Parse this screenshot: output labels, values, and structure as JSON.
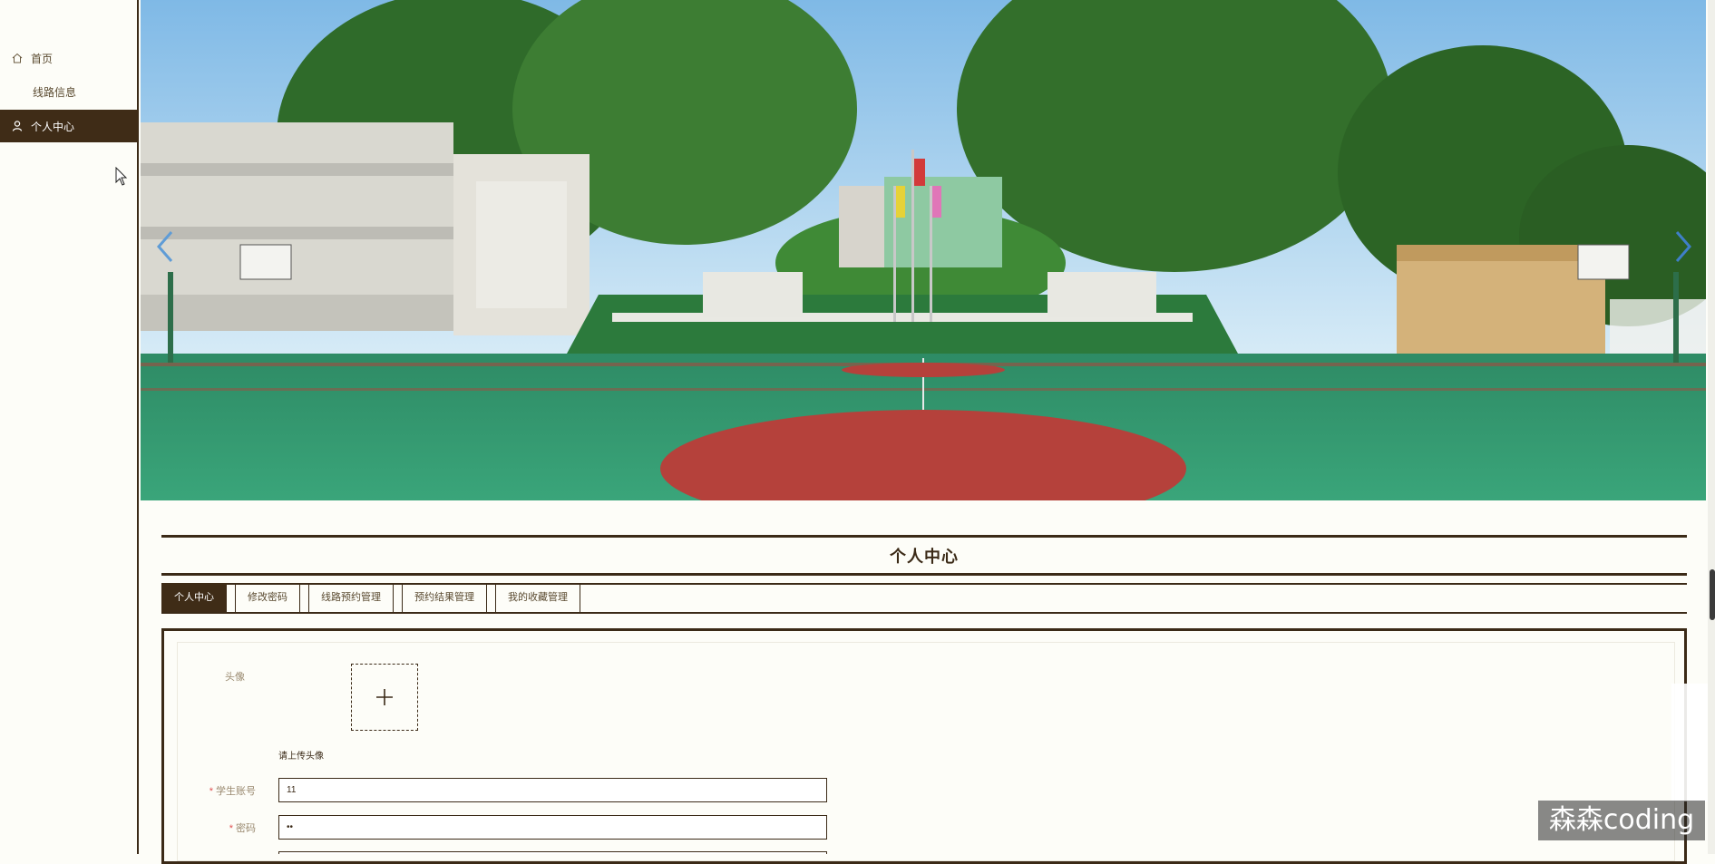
{
  "sidebar": {
    "items": [
      {
        "label": "首页",
        "icon": "home-icon"
      },
      {
        "label": "线路信息",
        "icon": ""
      },
      {
        "label": "个人中心",
        "icon": "user-icon",
        "active": true
      }
    ]
  },
  "banner": {
    "image": "school-campus-basketball-court-photo",
    "prev_icon": "chevron-left-icon",
    "next_icon": "chevron-right-icon"
  },
  "main": {
    "title": "个人中心",
    "tabs": [
      {
        "label": "个人中心",
        "active": true
      },
      {
        "label": "修改密码"
      },
      {
        "label": "线路预约管理"
      },
      {
        "label": "预约结果管理"
      },
      {
        "label": "我的收藏管理"
      }
    ],
    "form": {
      "avatar_label": "头像",
      "upload_tip": "请上传头像",
      "account_label": "学生账号",
      "account_value": "11",
      "password_label": "密码",
      "password_value": "••"
    }
  },
  "watermark": "森森coding",
  "colors": {
    "primary": "#3f2c17",
    "background": "#fdfdf8",
    "required": "#e05050"
  }
}
